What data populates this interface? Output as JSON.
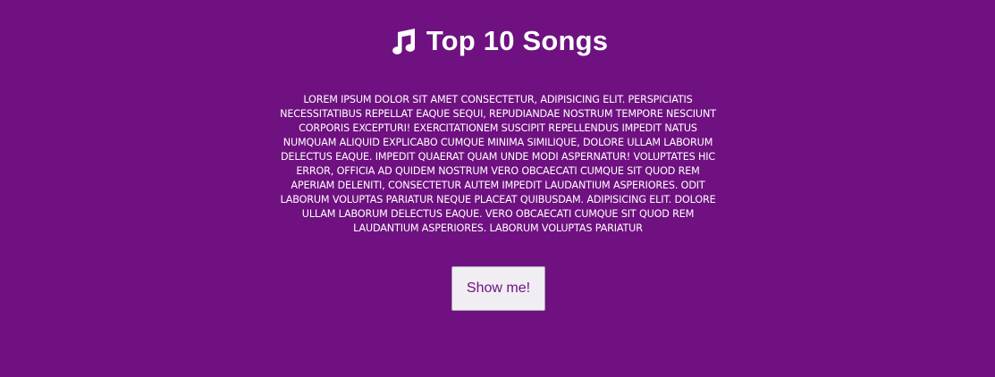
{
  "header": {
    "icon": "music-note-icon",
    "title": "Top 10 Songs"
  },
  "main": {
    "description": "Lorem ipsum dolor sit amet consectetur, adipisicing elit. Perspiciatis necessitatibus repellat eaque sequi, repudiandae nostrum tempore nesciunt corporis excepturi! Exercitationem suscipit repellendus impedit natus numquam aliquid explicabo cumque minima similique, dolore ullam laborum delectus eaque. Impedit quaerat quam unde modi aspernatur! Voluptates hic error, officia ad quidem nostrum vero obcaecati cumque sit quod rem aperiam deleniti, consectetur autem impedit laudantium asperiores. Odit laborum voluptas pariatur neque placeat quibusdam. adipisicing elit. Dolore ullam laborum delectus eaque. vero obcaecati cumque sit quod rem laudantium asperiores. laborum voluptas pariatur",
    "button_label": "Show me!"
  },
  "colors": {
    "background": "#6f1180",
    "text": "#ffffff",
    "button_background": "#f0eef2",
    "button_text": "#6f1180"
  }
}
